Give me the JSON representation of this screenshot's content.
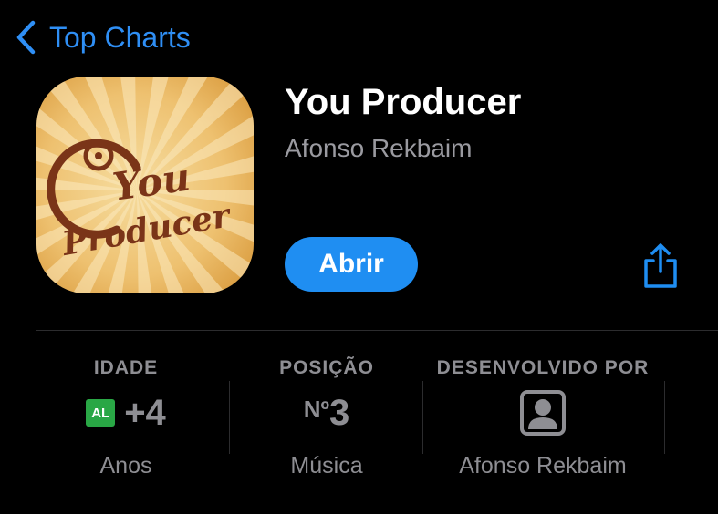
{
  "nav": {
    "back_label": "Top Charts"
  },
  "app": {
    "name": "You Producer",
    "developer": "Afonso Rekbaim",
    "icon_text_line1": "You",
    "icon_text_line2": "Producer",
    "open_label": "Abrir"
  },
  "info": {
    "age": {
      "label": "IDADE",
      "badge": "AL",
      "value": "+4",
      "sub": "Anos"
    },
    "rank": {
      "label": "POSIÇÃO",
      "prefix": "Nº",
      "value": "3",
      "sub": "Música"
    },
    "developer": {
      "label": "DESENVOLVIDO POR",
      "icon": "person-square-icon",
      "sub": "Afonso Rekbaim"
    }
  },
  "colors": {
    "accent": "#1f8ef2",
    "background": "#000000",
    "secondary_text": "#8e8e93",
    "age_badge": "#29a745"
  }
}
